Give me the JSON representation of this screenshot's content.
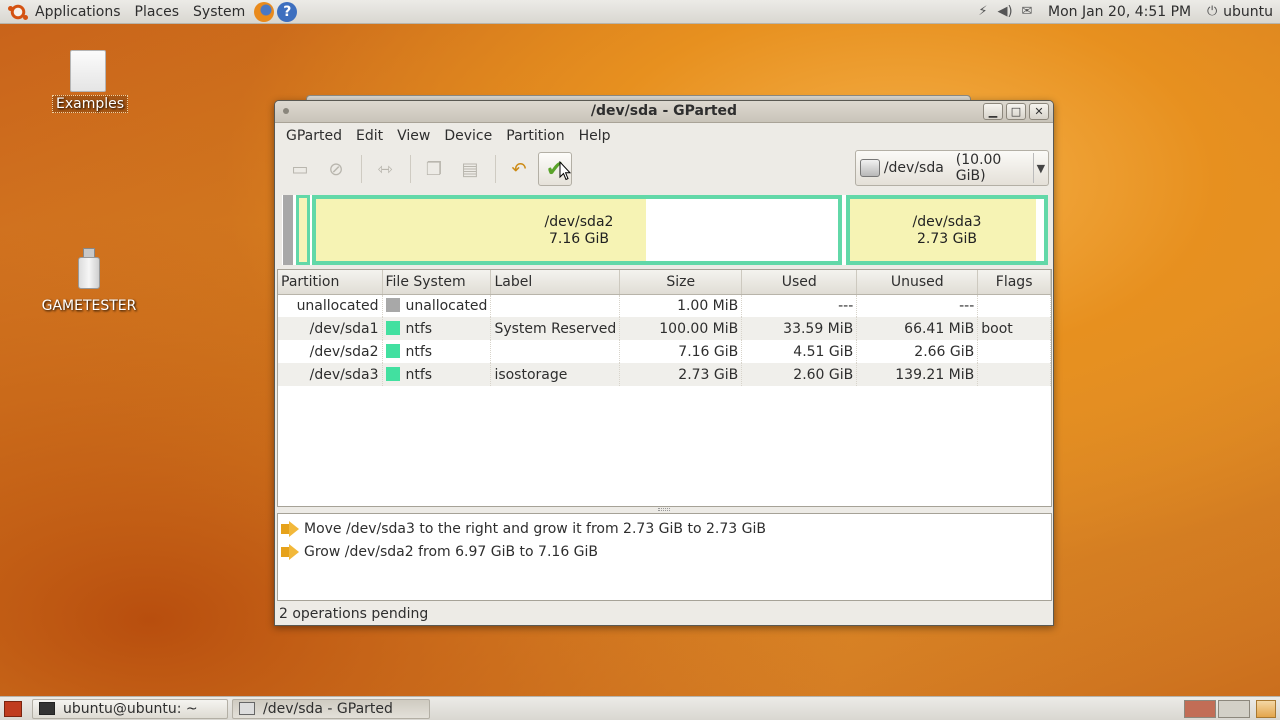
{
  "top_panel": {
    "menus": [
      "Applications",
      "Places",
      "System"
    ],
    "clock": "Mon Jan 20,  4:51 PM",
    "user": "ubuntu"
  },
  "desktop": {
    "icons": [
      {
        "label": "Examples"
      },
      {
        "label": "GAMETESTER"
      }
    ]
  },
  "window": {
    "title": "/dev/sda - GParted",
    "menu": [
      "GParted",
      "Edit",
      "View",
      "Device",
      "Partition",
      "Help"
    ],
    "device_selector": {
      "device": "/dev/sda",
      "size": "(10.00 GiB)"
    },
    "disk_map": {
      "sda2": {
        "name": "/dev/sda2",
        "size": "7.16 GiB"
      },
      "sda3": {
        "name": "/dev/sda3",
        "size": "2.73 GiB"
      }
    },
    "table": {
      "headers": [
        "Partition",
        "File System",
        "Label",
        "Size",
        "Used",
        "Unused",
        "Flags"
      ],
      "rows": [
        {
          "partition": "unallocated",
          "fs": "unallocated",
          "fs_color": "#a8a8a8",
          "label": "",
          "size": "1.00 MiB",
          "used": "---",
          "unused": "---",
          "flags": ""
        },
        {
          "partition": "/dev/sda1",
          "fs": "ntfs",
          "fs_color": "#42e0a0",
          "label": "System Reserved",
          "size": "100.00 MiB",
          "used": "33.59 MiB",
          "unused": "66.41 MiB",
          "flags": "boot"
        },
        {
          "partition": "/dev/sda2",
          "fs": "ntfs",
          "fs_color": "#42e0a0",
          "label": "",
          "size": "7.16 GiB",
          "used": "4.51 GiB",
          "unused": "2.66 GiB",
          "flags": ""
        },
        {
          "partition": "/dev/sda3",
          "fs": "ntfs",
          "fs_color": "#42e0a0",
          "label": "isostorage",
          "size": "2.73 GiB",
          "used": "2.60 GiB",
          "unused": "139.21 MiB",
          "flags": ""
        }
      ]
    },
    "operations": [
      "Move /dev/sda3 to the right and grow it from 2.73 GiB to 2.73 GiB",
      "Grow /dev/sda2 from 6.97 GiB to 7.16 GiB"
    ],
    "status": "2 operations pending"
  },
  "taskbar": {
    "tasks": [
      "ubuntu@ubuntu: ~",
      "/dev/sda - GParted"
    ]
  },
  "colors": {
    "ntfs": "#42e0a0",
    "unallocated": "#a8a8a8",
    "used_space": "#f6f3b4"
  }
}
